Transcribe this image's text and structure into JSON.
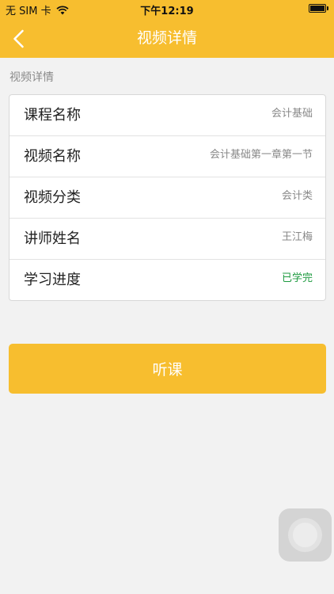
{
  "status_bar": {
    "carrier": "无 SIM 卡",
    "time": "下午12:19",
    "icons": [
      "wifi-icon",
      "battery-icon"
    ]
  },
  "nav": {
    "back_icon": "chevron-left-icon",
    "title": "视频详情"
  },
  "section_label": "视频详情",
  "details": [
    {
      "label": "课程名称",
      "value": "会计基础"
    },
    {
      "label": "视频名称",
      "value": "会计基础第一章第一节"
    },
    {
      "label": "视频分类",
      "value": "会计类"
    },
    {
      "label": "讲师姓名",
      "value": "王江梅"
    },
    {
      "label": "学习进度",
      "value": "已学完"
    }
  ],
  "action_button": {
    "label": "听课"
  },
  "assistive_touch_icon": "assistive-touch-icon",
  "colors": {
    "accent": "#f7be2f",
    "background": "#f2f2f2",
    "progress_done": "#1d9a3f"
  }
}
